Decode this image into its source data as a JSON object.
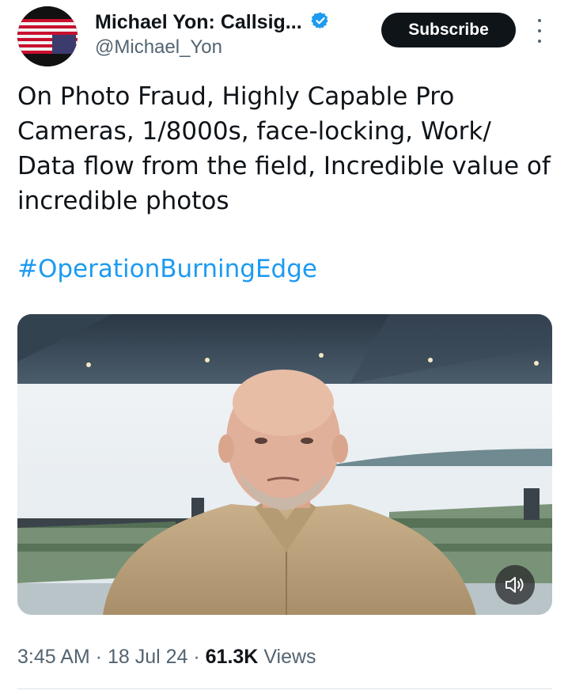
{
  "author": {
    "name": "Michael Yon: Callsig...",
    "handle": "@Michael_Yon",
    "avatar_icon": "flag-avatar-icon",
    "verified_icon": "verified-badge-icon"
  },
  "actions": {
    "subscribe_label": "Subscribe",
    "more_icon": "more-vertical-icon"
  },
  "tweet": {
    "text": "On Photo Fraud, Highly Capable Pro\nCameras, 1/8000s, face-locking, Work/\nData flow from the field, Incredible value of\nincredible photos",
    "hashtag": "#OperationBurningEdge"
  },
  "media": {
    "type": "video",
    "sound_icon": "speaker-icon"
  },
  "meta": {
    "time": "3:45 AM",
    "date": "18 Jul 24",
    "views_count": "61.3K",
    "views_label": "Views",
    "separator": " · "
  },
  "colors": {
    "accent": "#1d9bf0",
    "text": "#0f1419",
    "secondary": "#536471"
  }
}
